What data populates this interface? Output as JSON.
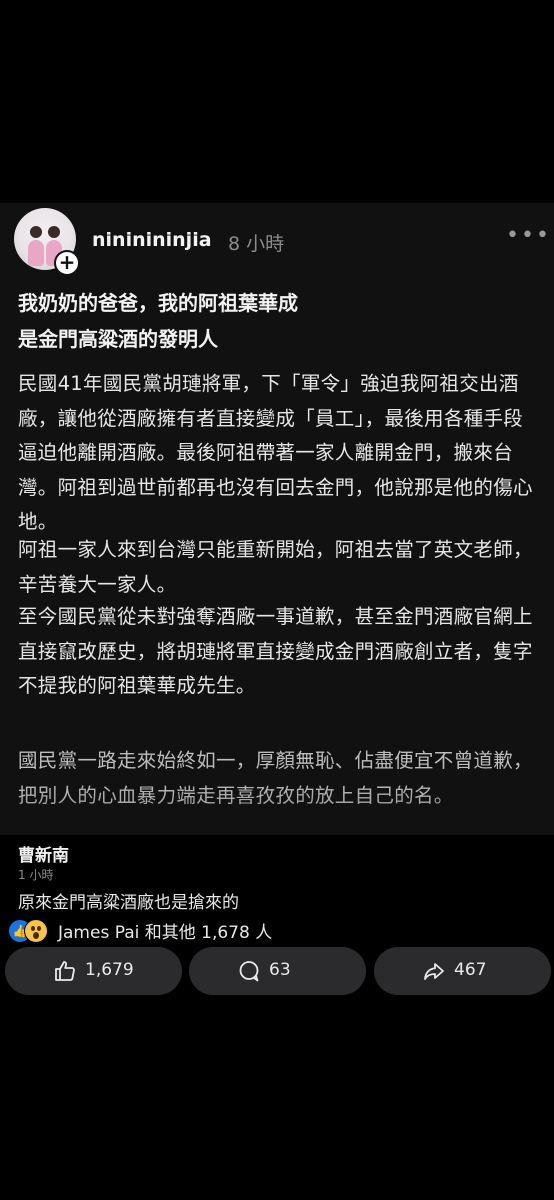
{
  "post": {
    "username": "nininininjia",
    "time": "8 小時",
    "title_lines": [
      "我奶奶的爸爸，我的阿祖葉華成",
      "是金門高粱酒的發明人"
    ],
    "paragraphs": [
      "民國41年國民黨胡璉將軍，下「軍令」強迫我阿祖交出酒廠，讓他從酒廠擁有者直接變成「員工」，最後用各種手段逼迫他離開酒廠。最後阿祖帶著一家人離開金門，搬來台灣。阿祖到過世前都再也沒有回去金門，他說那是他的傷心地。",
      "阿祖一家人來到台灣只能重新開始，阿祖去當了英文老師，辛苦養大一家人。",
      "至今國民黨從未對強奪酒廠一事道歉，甚至金門酒廠官網上直接竄改歷史，將胡璉將軍直接變成金門酒廠創立者，隻字不提我的阿祖葉華成先生。",
      "國民黨一路走來始終如一，厚顏無恥、佔盡便宜不曾道歉，把別人的心血暴力端走再喜孜孜的放上自己的名。"
    ]
  },
  "comment": {
    "author": "曹新南",
    "time": "1 小時",
    "text": "原來金門高粱酒廠也是搶來的"
  },
  "reactions": {
    "summary": "James  Pai 和其他 1,678 人",
    "icons": [
      "like-icon",
      "wow-icon"
    ]
  },
  "actions": {
    "like_count": "1,679",
    "comment_count": "63",
    "share_count": "467"
  },
  "colors": {
    "card_bg": "#111112",
    "button_bg": "#2b2b2d",
    "like_blue": "#1b74e4",
    "wow_yellow": "#f7c447"
  }
}
